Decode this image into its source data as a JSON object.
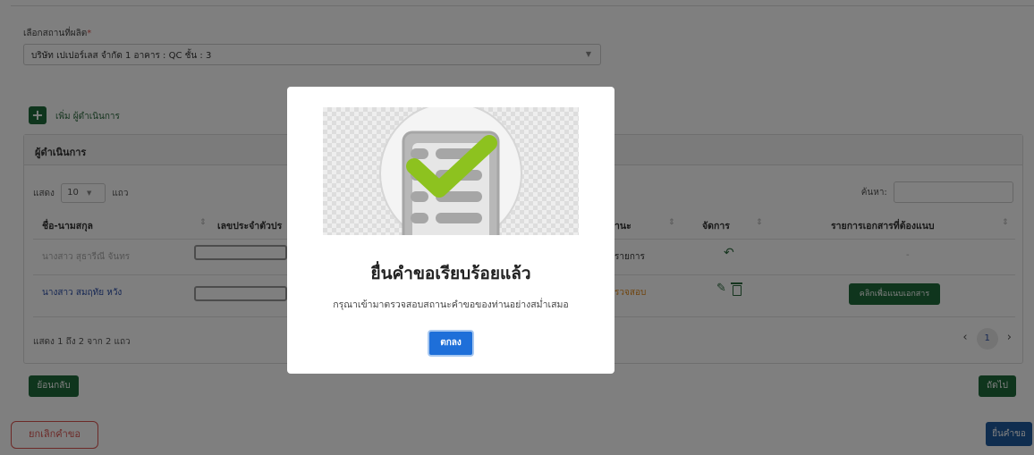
{
  "form": {
    "location_label": "เลือกสถานที่ผลิต",
    "required_mark": "*",
    "location_value": "บริษัท เปเปอร์เลส จำกัด 1 อาคาร : QC ชั้น : 3",
    "add_operator_label": "เพิ่ม ผู้ดำเนินการ"
  },
  "panel": {
    "title": "ผู้ดำเนินการ",
    "show_prefix": "แสดง",
    "page_length": "10",
    "show_suffix": "แถว",
    "search_label": "ค้นหา:",
    "columns": [
      "ชื่อ-นามสกุล",
      "เลขประจำตัวปร",
      "านะ",
      "จัดการ",
      "รายการเอกสารที่ต้องแนบ"
    ],
    "rows": [
      {
        "name": "นางสาว สุธารีณี จันทร",
        "status": "รายการ",
        "docs": "-"
      },
      {
        "name": "นางสาว สมฤทัย หวัง",
        "status": "รวจสอบ",
        "docs_button": "คลิกเพื่อแนบเอกสาร"
      }
    ],
    "info": "แสดง 1 ถึง 2 จาก 2 แถว",
    "current_page": "1"
  },
  "nav": {
    "back": "ย้อนกลับ",
    "next": "ถัดไป"
  },
  "footer": {
    "cancel": "ยกเลิกคำขอ",
    "submit": "ยื่นคำขอ"
  },
  "modal": {
    "title": "ยื่นคำขอเรียบร้อยแล้ว",
    "message": "กรุณาเข้ามาตรวจสอบสถานะคำขอของท่านอย่างสม่ำเสมอ",
    "ok": "ตกลง"
  },
  "colors": {
    "primary_green": "#1e6b3a",
    "modal_button": "#1e6fd9",
    "cancel_red": "#d9534f",
    "check_green": "#8dc21f"
  }
}
